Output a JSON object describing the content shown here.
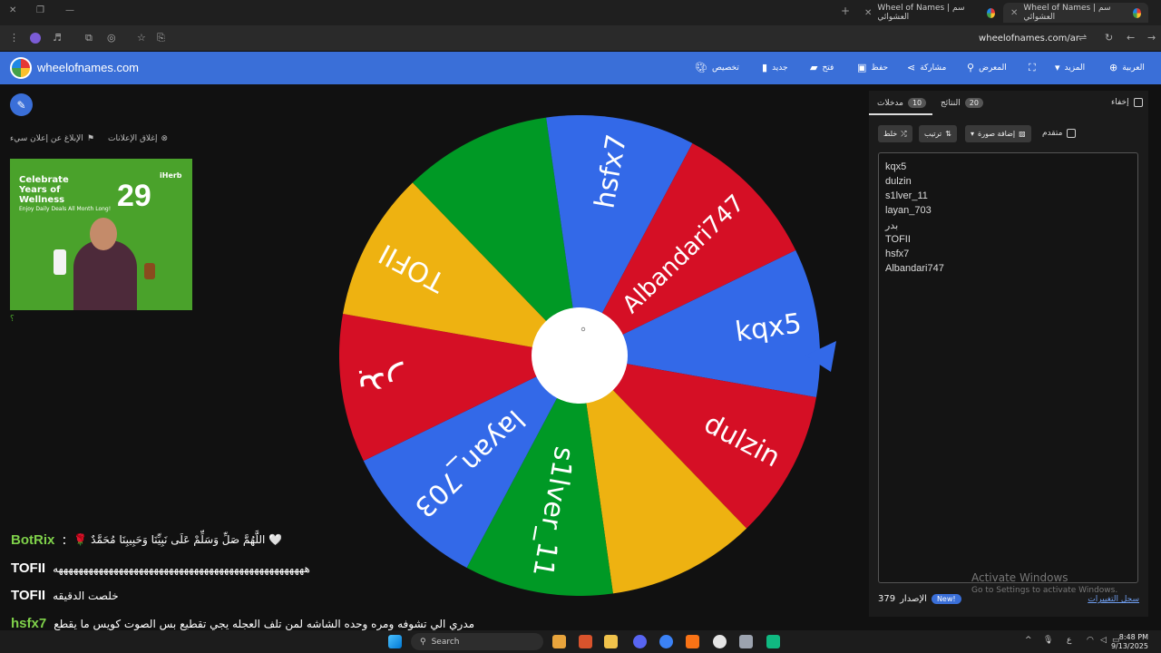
{
  "browser": {
    "tabs": [
      {
        "title": "Wheel of Names | سم العشوائي",
        "active": true
      },
      {
        "title": "Wheel of Names | سم العشوائي",
        "active": false
      }
    ],
    "new_tab": "+",
    "url": "wheelofnames.com/ar"
  },
  "header": {
    "brand": "wheelofnames.com",
    "nav": {
      "customize": "تخصيص",
      "new": "جديد",
      "open": "فتح",
      "save": "حفظ",
      "share": "مشاركة",
      "gallery": "المعرض",
      "more": "المزيد",
      "language": "العربية"
    }
  },
  "left": {
    "close_ads": "إغلاق الإعلانات",
    "report_ad": "الإبلاغ عن إعلان سيء",
    "ad": {
      "headline": "Celebrate Years of Wellness",
      "number": "29",
      "brand": "iHerb",
      "subline": "Enjoy Daily Deals All Month Long!"
    },
    "qmark": "؟"
  },
  "chat": [
    {
      "user": "BotRix",
      "sep": ":",
      "message": "🌹 اللَّهُمَّ صَلِّ وَسَلِّمْ عَلَى نَبِيِّنَا وَحَبِيبِنَا مُحَمَّدٌ 🤍"
    },
    {
      "user": "TOFII",
      "message": "ههههههههههههههههههههههههههههههههههههههههههههههههههه"
    },
    {
      "user": "TOFII",
      "message": "خلصت الدقيقه"
    },
    {
      "user": "hsfx7",
      "message": "مدري الي تشوفه ومره وحده الشاشه لمن تلف العجله يجي تقطيع بس الصوت كويس ما يقطع"
    }
  ],
  "wheel": {
    "segments": [
      {
        "label": "kqx5",
        "color": "#3369e8"
      },
      {
        "label": "dulzin",
        "color": "#d50f25"
      },
      {
        "label": "",
        "color": "#eeb211"
      },
      {
        "label": "s1lver_11",
        "color": "#009925"
      },
      {
        "label": "layan_703",
        "color": "#3369e8"
      },
      {
        "label": "بدر",
        "color": "#d50f25"
      },
      {
        "label": "TOFII",
        "color": "#eeb211"
      },
      {
        "label": "",
        "color": "#009925"
      },
      {
        "label": "hsfx7",
        "color": "#3369e8"
      },
      {
        "label": "Albandari747",
        "color": "#d50f25"
      }
    ],
    "pointer_color": "#3369e8"
  },
  "panel": {
    "hide_label": "إخفاء",
    "results_tab": "النتائج",
    "results_count": "20",
    "entries_tab": "مدخلات",
    "entries_count": "10",
    "shuffle": "خلط",
    "sort": "ترتيب",
    "add_image": "إضافة صورة",
    "advanced": "متقدم",
    "entries": [
      "kqx5",
      "dulzin",
      "s1lver_11",
      "layan_703",
      "بدر",
      "TOFII",
      "hsfx7",
      "Albandari747"
    ],
    "version_label": "الإصدار",
    "version": "379",
    "new_badge": "New!",
    "changelog": "سجل التغييرات"
  },
  "watermark": {
    "line1": "Activate Windows",
    "line2": "Go to Settings to activate Windows."
  },
  "taskbar": {
    "search": "Search",
    "time": "8:48 PM",
    "date": "9/13/2025",
    "lang": "ع"
  }
}
